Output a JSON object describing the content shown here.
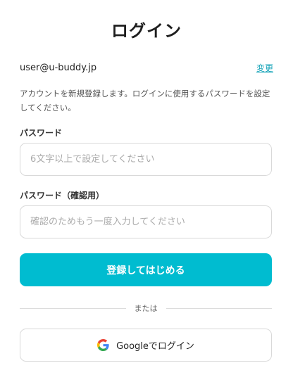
{
  "page": {
    "title": "ログイン"
  },
  "account": {
    "email": "user@u-buddy.jp",
    "change_label": "変更"
  },
  "description": "アカウントを新規登録します。ログインに使用するパスワードを設定してください。",
  "form": {
    "password": {
      "label": "パスワード",
      "placeholder": "6文字以上で設定してください",
      "value": ""
    },
    "password_confirm": {
      "label": "パスワード（確認用）",
      "placeholder": "確認のためもう一度入力してください",
      "value": ""
    },
    "submit_label": "登録してはじめる"
  },
  "divider_label": "または",
  "google": {
    "label": "Googleでログイン",
    "icon": "google-icon"
  },
  "colors": {
    "accent": "#00bcd0",
    "link": "#14a3b8"
  }
}
